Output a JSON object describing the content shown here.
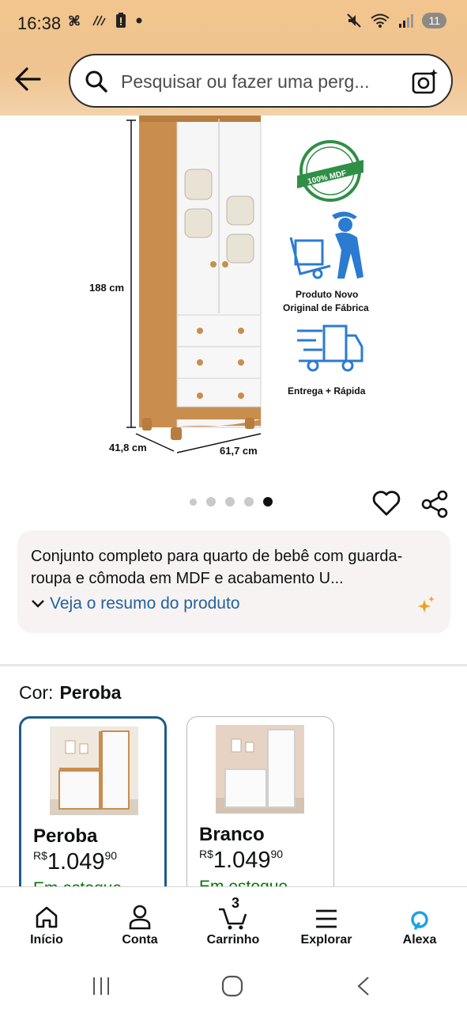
{
  "status_bar": {
    "time": "16:38",
    "battery": "11",
    "icons_left": [
      "fan-icon",
      "signal-lines-icon",
      "battery-alert-icon",
      "dot-icon"
    ],
    "icons_right": [
      "mute-icon",
      "wifi-icon",
      "cell-signal-icon"
    ]
  },
  "search": {
    "placeholder": "Pesquisar ou fazer uma perg...",
    "back_icon": "arrow-left-icon",
    "search_icon": "search-icon",
    "camera_icon": "camera-sparkle-icon"
  },
  "product_image": {
    "height_label": "188 cm",
    "depth_label": "41,8 cm",
    "width_label": "61,7 cm",
    "badge_text": "100% MDF",
    "feature1": [
      "Produto Novo",
      "Original de Fábrica"
    ],
    "feature2": "Entrega + Rápida"
  },
  "carousel": {
    "count": 5,
    "active_index": 4
  },
  "summary": {
    "text": "Conjunto completo para quarto de bebê com guarda-roupa e cômoda em MDF e acabamento U...",
    "link": "Veja o resumo do produto"
  },
  "variant": {
    "label": "Cor:",
    "selected": "Peroba",
    "options": [
      {
        "name": "Peroba",
        "currency": "R$",
        "price_int": "1.049",
        "price_cents": "90",
        "stock": "Em estoque"
      },
      {
        "name": "Branco",
        "currency": "R$",
        "price_int": "1.049",
        "price_cents": "90",
        "stock": "Em estoque"
      }
    ]
  },
  "bottom_nav": {
    "items": [
      {
        "label": "Início",
        "icon": "home-icon"
      },
      {
        "label": "Conta",
        "icon": "person-icon"
      },
      {
        "label": "Carrinho",
        "icon": "cart-icon",
        "badge": "3"
      },
      {
        "label": "Explorar",
        "icon": "menu-icon"
      },
      {
        "label": "Alexa",
        "icon": "alexa-icon"
      }
    ]
  },
  "colors": {
    "header": "#f2c58e",
    "link": "#2162a1",
    "stock": "#007600",
    "selected_border": "#1e5b8a"
  }
}
